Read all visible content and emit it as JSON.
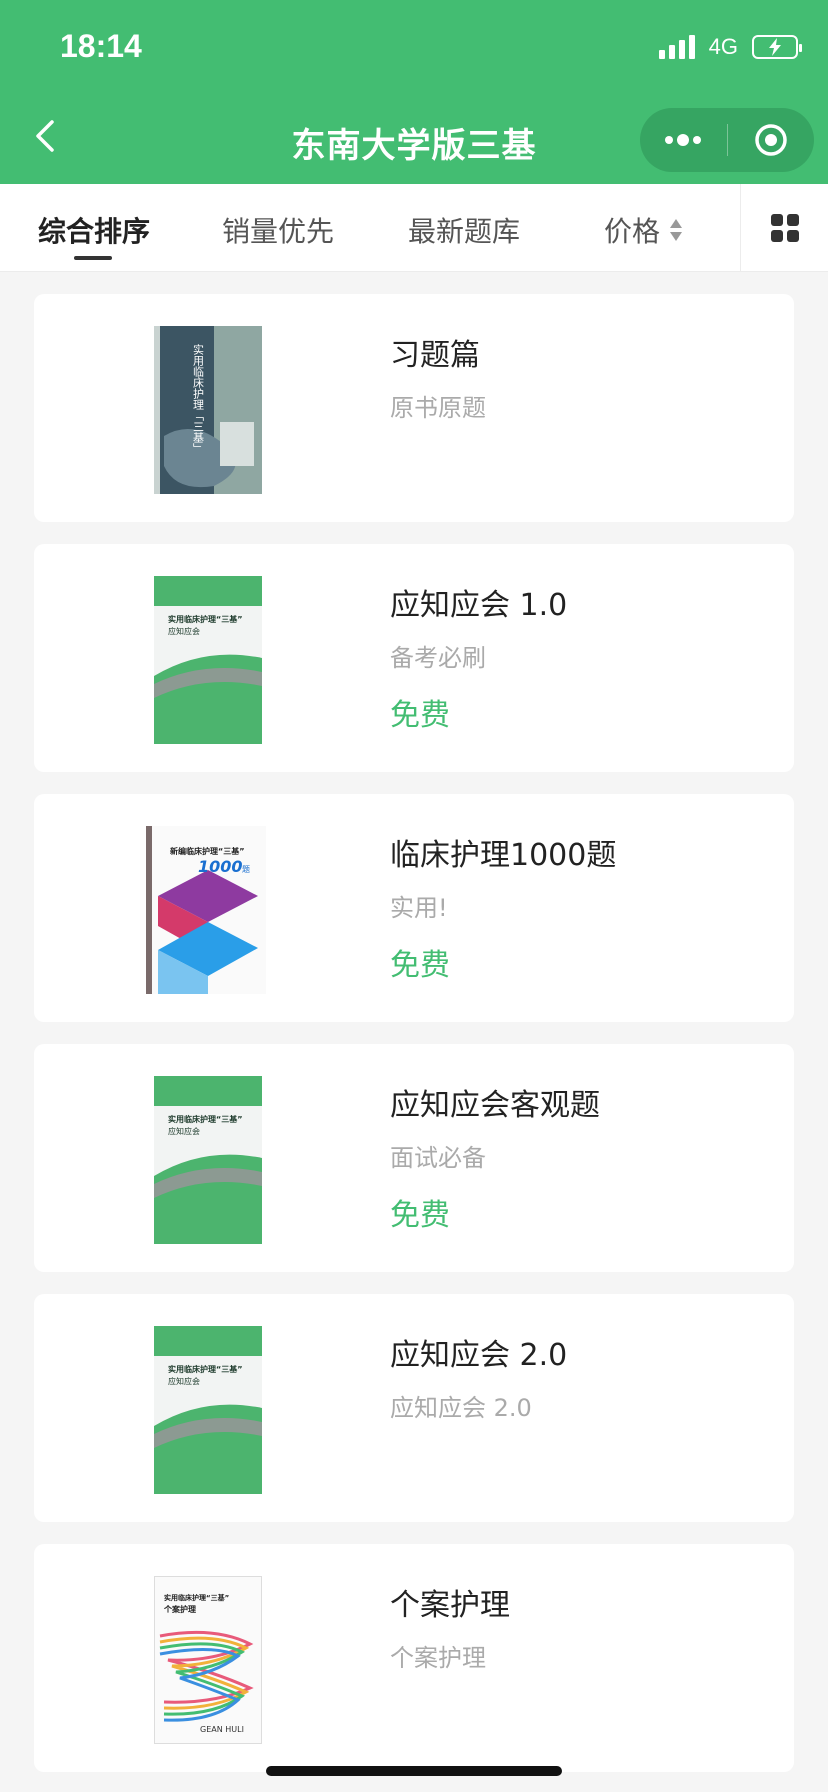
{
  "status": {
    "time": "18:14",
    "network": "4G"
  },
  "header": {
    "title": "东南大学版三基"
  },
  "tabs": [
    {
      "label": "综合排序"
    },
    {
      "label": "销量优先"
    },
    {
      "label": "最新题库"
    },
    {
      "label": "价格"
    }
  ],
  "colors": {
    "brand": "#43bd72",
    "price": "#43bd72"
  },
  "items": [
    {
      "title": "习题篇",
      "subtitle": "原书原题",
      "price": ""
    },
    {
      "title": "应知应会 1.0",
      "subtitle": "备考必刷",
      "price": "免费"
    },
    {
      "title": "临床护理1000题",
      "subtitle": "实用!",
      "price": "免费"
    },
    {
      "title": "应知应会客观题",
      "subtitle": "面试必备",
      "price": "免费"
    },
    {
      "title": "应知应会 2.0",
      "subtitle": "应知应会 2.0",
      "price": ""
    },
    {
      "title": "个案护理",
      "subtitle": "个案护理",
      "price": ""
    }
  ],
  "covers": {
    "c1": {
      "text": "实用临床护理「三基」"
    },
    "c2": {
      "line1": "实用临床护理“三基”",
      "line2": "应知应会"
    },
    "c3": {
      "line1": "新编临床护理“三基”",
      "line2": "1000",
      "suffix": "题"
    },
    "c4": {
      "line1": "实用临床护理“三基”",
      "line2": "应知应会"
    },
    "c5": {
      "line1": "实用临床护理“三基”",
      "line2": "应知应会"
    },
    "c6": {
      "line1": "实用临床护理“三基”",
      "line2": "个案护理",
      "en": "GEAN HULI"
    }
  }
}
